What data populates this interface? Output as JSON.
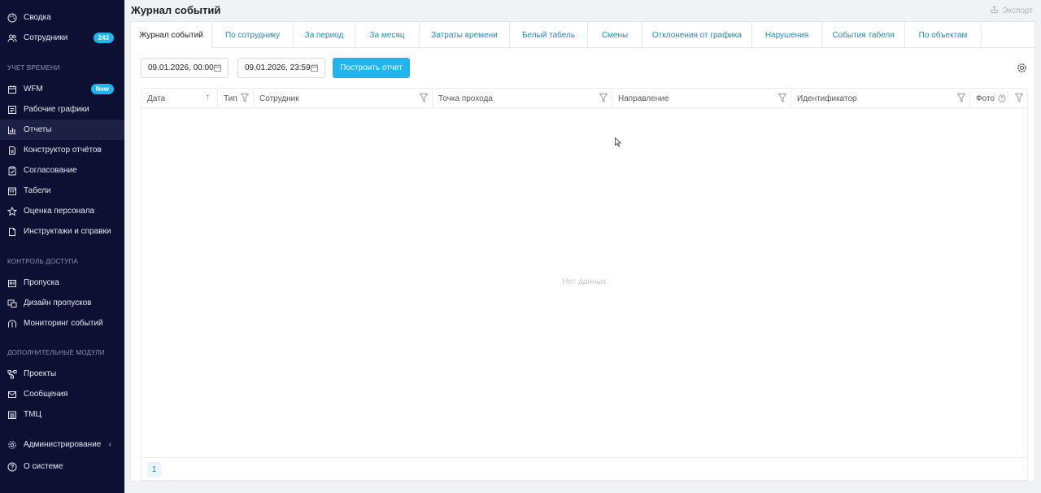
{
  "sidebar": {
    "top_items": [
      {
        "label": "Сводка",
        "icon": "palette-icon"
      },
      {
        "label": "Сотрудники",
        "icon": "users-icon",
        "badge": "243"
      }
    ],
    "sections": {
      "time": "Учет времени",
      "access": "Контроль доступа",
      "extra": "Дополнительные модули"
    },
    "time_items": [
      {
        "label": "WFM",
        "icon": "calendar-icon",
        "badge": "New"
      },
      {
        "label": "Рабочие графики",
        "icon": "schedule-icon"
      },
      {
        "label": "Отчеты",
        "icon": "chart-icon",
        "active": true
      },
      {
        "label": "Конструктор отчётов",
        "icon": "document-icon"
      },
      {
        "label": "Согласование",
        "icon": "clipboard-check-icon"
      },
      {
        "label": "Табели",
        "icon": "calendar-grid-icon"
      },
      {
        "label": "Оценка персонала",
        "icon": "star-icon"
      },
      {
        "label": "Инструктажи и справки",
        "icon": "file-icon"
      }
    ],
    "access_items": [
      {
        "label": "Пропуска",
        "icon": "id-card-icon"
      },
      {
        "label": "Дизайн пропусков",
        "icon": "design-icon"
      },
      {
        "label": "Мониторинг событий",
        "icon": "monitor-icon"
      }
    ],
    "extra_items": [
      {
        "label": "Проекты",
        "icon": "project-icon"
      },
      {
        "label": "Сообщения",
        "icon": "mail-icon"
      },
      {
        "label": "ТМЦ",
        "icon": "inventory-icon"
      }
    ],
    "bottom_items": [
      {
        "label": "Администрирование",
        "icon": "gear-icon",
        "chevron": "‹"
      },
      {
        "label": "О системе",
        "icon": "help-icon"
      }
    ]
  },
  "header": {
    "title": "Журнал событий",
    "export_label": "Экспорт"
  },
  "tabs": [
    {
      "label": "Журнал событий",
      "active": true
    },
    {
      "label": "По сотруднику"
    },
    {
      "label": "За период"
    },
    {
      "label": "За месяц"
    },
    {
      "label": "Затраты времени"
    },
    {
      "label": "Белый табель"
    },
    {
      "label": "Смены"
    },
    {
      "label": "Отклонения от графика"
    },
    {
      "label": "Нарушения"
    },
    {
      "label": "События табеля"
    },
    {
      "label": "По объектам"
    }
  ],
  "filters": {
    "date_from": "09.01.2026, 00:00",
    "date_to": "09.01.2026, 23:59",
    "build_label": "Построить отчет"
  },
  "table": {
    "columns": [
      {
        "label": "Дата",
        "sort": "↑"
      },
      {
        "label": "Тип",
        "filter": true
      },
      {
        "label": "Сотрудник",
        "filter": true
      },
      {
        "label": "Точка прохода",
        "filter": true
      },
      {
        "label": "Направление",
        "filter": true
      },
      {
        "label": "Идентификатор",
        "filter": true
      },
      {
        "label": "Фото",
        "filter": true,
        "help": true
      }
    ],
    "empty_text": "Нет данных"
  },
  "pagination": {
    "current_page": "1"
  },
  "colors": {
    "sidebar_bg": "#0d1033",
    "accent": "#21b4ef",
    "tab_text": "#1a8fc0"
  }
}
